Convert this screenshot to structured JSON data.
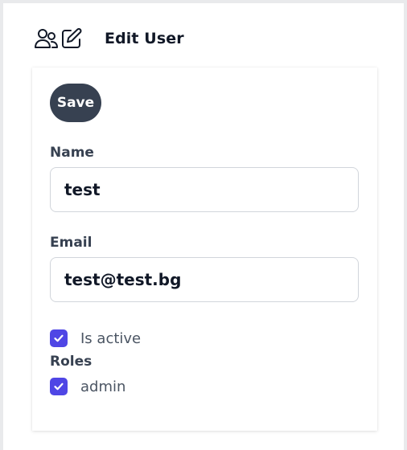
{
  "header": {
    "title": "Edit User",
    "icons": [
      "users-icon",
      "edit-icon"
    ]
  },
  "form": {
    "save_label": "Save",
    "name": {
      "label": "Name",
      "value": "test"
    },
    "email": {
      "label": "Email",
      "value": "test@test.bg"
    },
    "is_active": {
      "label": "Is active",
      "checked": true
    },
    "roles": {
      "label": "Roles",
      "items": [
        {
          "label": "admin",
          "checked": true
        }
      ]
    }
  },
  "colors": {
    "primary_button": "#374151",
    "checkbox_accent": "#4f46e5",
    "text_dark": "#111827",
    "label_text": "#374151",
    "input_border": "#d1d5db"
  }
}
